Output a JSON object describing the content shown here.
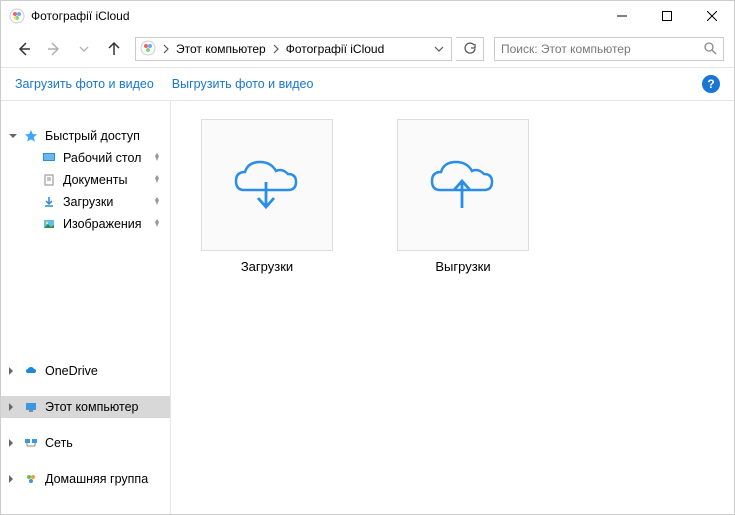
{
  "titlebar": {
    "title": "Фотографії iCloud"
  },
  "breadcrumbs": {
    "item0": "Этот компьютер",
    "item1": "Фотографії iCloud"
  },
  "search": {
    "placeholder": "Поиск: Этот компьютер"
  },
  "cmdbar": {
    "download": "Загрузить фото и видео",
    "upload": "Выгрузить фото и видео"
  },
  "sidebar": {
    "quick_access": "Быстрый доступ",
    "desktop": "Рабочий стол",
    "documents": "Документы",
    "downloads": "Загрузки",
    "pictures": "Изображения",
    "onedrive": "OneDrive",
    "this_pc": "Этот компьютер",
    "network": "Сеть",
    "homegroup": "Домашняя группа"
  },
  "main": {
    "folder0": "Загрузки",
    "folder1": "Выгрузки"
  }
}
